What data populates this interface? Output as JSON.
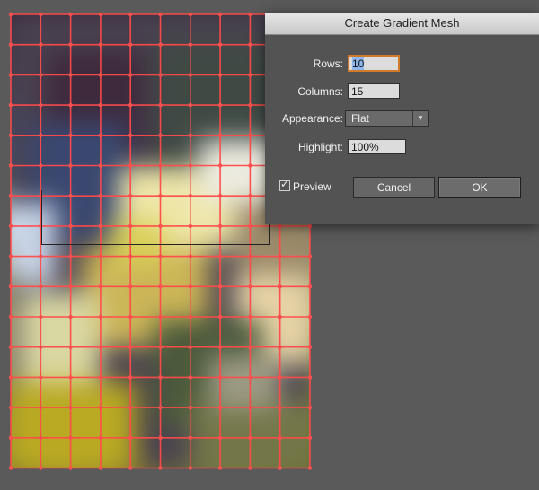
{
  "dialog": {
    "title": "Create Gradient Mesh",
    "rows_label": "Rows:",
    "rows_value": "10",
    "columns_label": "Columns:",
    "columns_value": "15",
    "appearance_label": "Appearance:",
    "appearance_value": "Flat",
    "appearance_arrow_icon": "chevron-down-icon",
    "highlight_label": "Highlight:",
    "highlight_value": "100%",
    "preview_label": "Preview",
    "preview_checked": true,
    "cancel_label": "Cancel",
    "ok_label": "OK"
  },
  "colors": {
    "mesh_line": "#ff4a4a",
    "app_background": "#5a5a5a",
    "dialog_background": "#535353",
    "focus_ring": "#d07a2a"
  }
}
